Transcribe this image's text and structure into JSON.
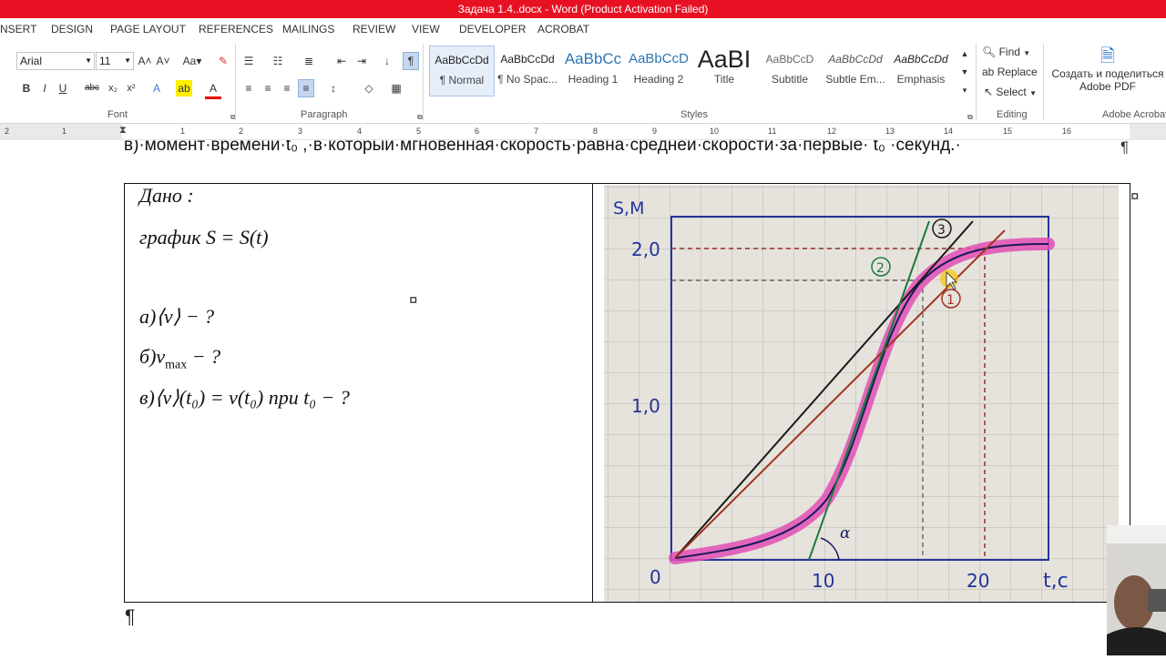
{
  "window": {
    "title": "Задача 1.4..docx -  Word (Product Activation Failed)"
  },
  "tabs": [
    "NSERT",
    "DESIGN",
    "PAGE LAYOUT",
    "REFERENCES",
    "MAILINGS",
    "REVIEW",
    "VIEW",
    "DEVELOPER",
    "ACROBAT"
  ],
  "font": {
    "name": "Arial",
    "size": "11",
    "group_label": "Font"
  },
  "paragraph": {
    "group_label": "Paragraph"
  },
  "styles": {
    "group_label": "Styles",
    "items": [
      {
        "preview": "AaBbCcDd",
        "name": "¶ Normal"
      },
      {
        "preview": "AaBbCcDd",
        "name": "¶ No Spac..."
      },
      {
        "preview": "AaBbCc",
        "name": "Heading 1"
      },
      {
        "preview": "AaBbCcD",
        "name": "Heading 2"
      },
      {
        "preview": "AaBI",
        "name": "Title"
      },
      {
        "preview": "AaBbCcD",
        "name": "Subtitle"
      },
      {
        "preview": "AaBbCcDd",
        "name": "Subtle Em..."
      },
      {
        "preview": "AaBbCcDd",
        "name": "Emphasis"
      }
    ]
  },
  "editing": {
    "find": "Find",
    "replace": "Replace",
    "select": "Select",
    "group_label": "Editing"
  },
  "acrobat": {
    "create": "Создать и поделиться",
    "pdf": "Adobe PDF",
    "group_label": "Adobe Acrobat"
  },
  "ruler": [
    "2",
    "1",
    "1",
    "2",
    "3",
    "4",
    "5",
    "6",
    "7",
    "8",
    "9",
    "10",
    "11",
    "12",
    "13",
    "14",
    "15",
    "16"
  ],
  "document": {
    "top_line": "в)·момент·времени·t₀ ,·в·который·мгновенная·скорость·равна·средней·скорости·за·первые· t₀ ·секунд.·",
    "pilcrow": "¶",
    "cell_mark": "¤",
    "given": "Дано :",
    "graph": "график S = S(t)",
    "q_a": "а)⟨v⟩ − ?",
    "q_b_prefix": "б)v",
    "q_b_sub": "max",
    "q_b_suffix": " − ?",
    "q_c": "в)⟨v⟩(t₀) = v(t₀) при t₀ − ?"
  },
  "photo": {
    "y_label": "S,M",
    "x_label": "t,c",
    "y_ticks": [
      "2,0",
      "1,0",
      "0"
    ],
    "x_ticks": [
      "10",
      "20"
    ],
    "line_labels": [
      "1",
      "2",
      "3"
    ],
    "angle_label": "α"
  }
}
